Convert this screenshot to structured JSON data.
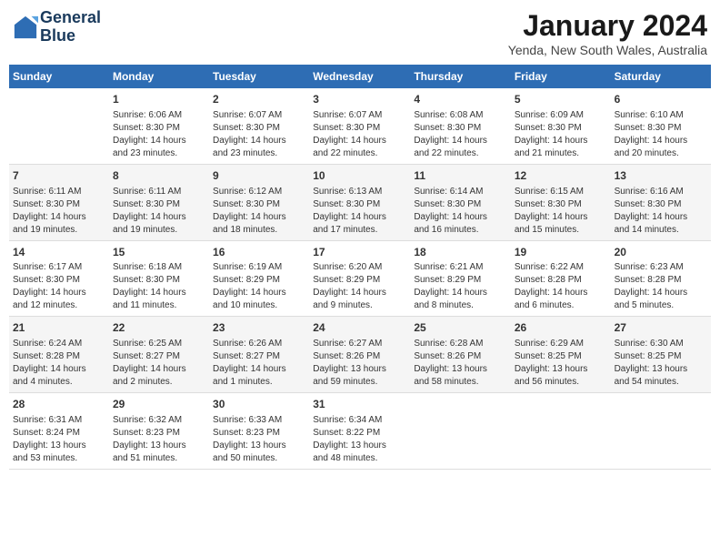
{
  "logo": {
    "line1": "General",
    "line2": "Blue"
  },
  "title": "January 2024",
  "subtitle": "Yenda, New South Wales, Australia",
  "days": [
    "Sunday",
    "Monday",
    "Tuesday",
    "Wednesday",
    "Thursday",
    "Friday",
    "Saturday"
  ],
  "weeks": [
    [
      {
        "date": "",
        "info": ""
      },
      {
        "date": "1",
        "info": "Sunrise: 6:06 AM\nSunset: 8:30 PM\nDaylight: 14 hours\nand 23 minutes."
      },
      {
        "date": "2",
        "info": "Sunrise: 6:07 AM\nSunset: 8:30 PM\nDaylight: 14 hours\nand 23 minutes."
      },
      {
        "date": "3",
        "info": "Sunrise: 6:07 AM\nSunset: 8:30 PM\nDaylight: 14 hours\nand 22 minutes."
      },
      {
        "date": "4",
        "info": "Sunrise: 6:08 AM\nSunset: 8:30 PM\nDaylight: 14 hours\nand 22 minutes."
      },
      {
        "date": "5",
        "info": "Sunrise: 6:09 AM\nSunset: 8:30 PM\nDaylight: 14 hours\nand 21 minutes."
      },
      {
        "date": "6",
        "info": "Sunrise: 6:10 AM\nSunset: 8:30 PM\nDaylight: 14 hours\nand 20 minutes."
      }
    ],
    [
      {
        "date": "7",
        "info": "Sunrise: 6:11 AM\nSunset: 8:30 PM\nDaylight: 14 hours\nand 19 minutes."
      },
      {
        "date": "8",
        "info": "Sunrise: 6:11 AM\nSunset: 8:30 PM\nDaylight: 14 hours\nand 19 minutes."
      },
      {
        "date": "9",
        "info": "Sunrise: 6:12 AM\nSunset: 8:30 PM\nDaylight: 14 hours\nand 18 minutes."
      },
      {
        "date": "10",
        "info": "Sunrise: 6:13 AM\nSunset: 8:30 PM\nDaylight: 14 hours\nand 17 minutes."
      },
      {
        "date": "11",
        "info": "Sunrise: 6:14 AM\nSunset: 8:30 PM\nDaylight: 14 hours\nand 16 minutes."
      },
      {
        "date": "12",
        "info": "Sunrise: 6:15 AM\nSunset: 8:30 PM\nDaylight: 14 hours\nand 15 minutes."
      },
      {
        "date": "13",
        "info": "Sunrise: 6:16 AM\nSunset: 8:30 PM\nDaylight: 14 hours\nand 14 minutes."
      }
    ],
    [
      {
        "date": "14",
        "info": "Sunrise: 6:17 AM\nSunset: 8:30 PM\nDaylight: 14 hours\nand 12 minutes."
      },
      {
        "date": "15",
        "info": "Sunrise: 6:18 AM\nSunset: 8:30 PM\nDaylight: 14 hours\nand 11 minutes."
      },
      {
        "date": "16",
        "info": "Sunrise: 6:19 AM\nSunset: 8:29 PM\nDaylight: 14 hours\nand 10 minutes."
      },
      {
        "date": "17",
        "info": "Sunrise: 6:20 AM\nSunset: 8:29 PM\nDaylight: 14 hours\nand 9 minutes."
      },
      {
        "date": "18",
        "info": "Sunrise: 6:21 AM\nSunset: 8:29 PM\nDaylight: 14 hours\nand 8 minutes."
      },
      {
        "date": "19",
        "info": "Sunrise: 6:22 AM\nSunset: 8:28 PM\nDaylight: 14 hours\nand 6 minutes."
      },
      {
        "date": "20",
        "info": "Sunrise: 6:23 AM\nSunset: 8:28 PM\nDaylight: 14 hours\nand 5 minutes."
      }
    ],
    [
      {
        "date": "21",
        "info": "Sunrise: 6:24 AM\nSunset: 8:28 PM\nDaylight: 14 hours\nand 4 minutes."
      },
      {
        "date": "22",
        "info": "Sunrise: 6:25 AM\nSunset: 8:27 PM\nDaylight: 14 hours\nand 2 minutes."
      },
      {
        "date": "23",
        "info": "Sunrise: 6:26 AM\nSunset: 8:27 PM\nDaylight: 14 hours\nand 1 minutes."
      },
      {
        "date": "24",
        "info": "Sunrise: 6:27 AM\nSunset: 8:26 PM\nDaylight: 13 hours\nand 59 minutes."
      },
      {
        "date": "25",
        "info": "Sunrise: 6:28 AM\nSunset: 8:26 PM\nDaylight: 13 hours\nand 58 minutes."
      },
      {
        "date": "26",
        "info": "Sunrise: 6:29 AM\nSunset: 8:25 PM\nDaylight: 13 hours\nand 56 minutes."
      },
      {
        "date": "27",
        "info": "Sunrise: 6:30 AM\nSunset: 8:25 PM\nDaylight: 13 hours\nand 54 minutes."
      }
    ],
    [
      {
        "date": "28",
        "info": "Sunrise: 6:31 AM\nSunset: 8:24 PM\nDaylight: 13 hours\nand 53 minutes."
      },
      {
        "date": "29",
        "info": "Sunrise: 6:32 AM\nSunset: 8:23 PM\nDaylight: 13 hours\nand 51 minutes."
      },
      {
        "date": "30",
        "info": "Sunrise: 6:33 AM\nSunset: 8:23 PM\nDaylight: 13 hours\nand 50 minutes."
      },
      {
        "date": "31",
        "info": "Sunrise: 6:34 AM\nSunset: 8:22 PM\nDaylight: 13 hours\nand 48 minutes."
      },
      {
        "date": "",
        "info": ""
      },
      {
        "date": "",
        "info": ""
      },
      {
        "date": "",
        "info": ""
      }
    ]
  ]
}
